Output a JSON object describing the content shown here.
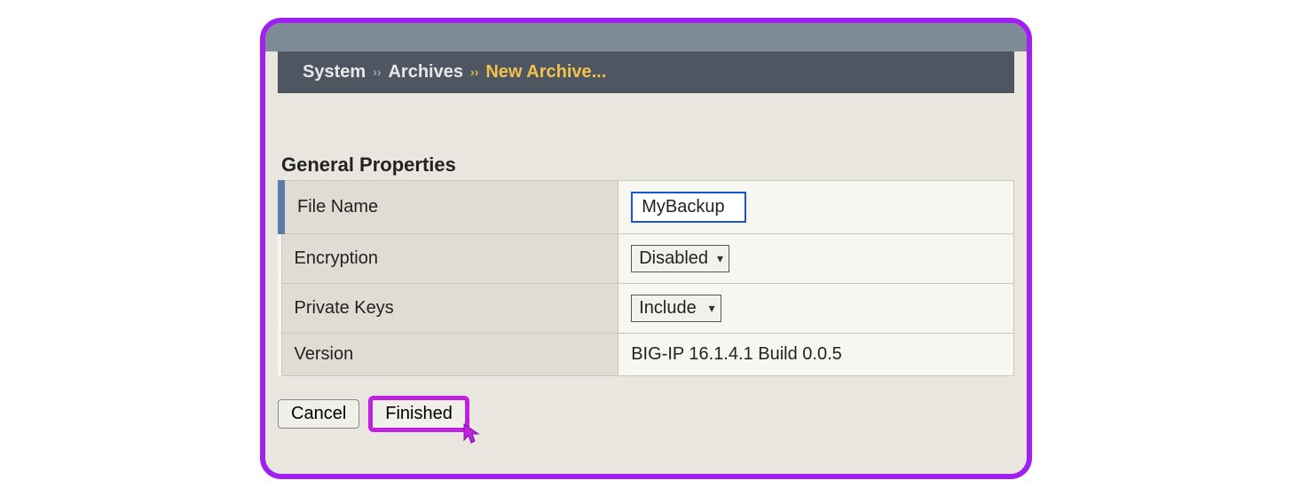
{
  "breadcrumb": {
    "item1": "System",
    "item2": "Archives",
    "active": "New Archive...",
    "sep": "››"
  },
  "section_title": "General Properties",
  "rows": {
    "file_name_label": "File Name",
    "file_name_value": "MyBackup",
    "encryption_label": "Encryption",
    "encryption_value": "Disabled",
    "private_keys_label": "Private Keys",
    "private_keys_value": "Include",
    "version_label": "Version",
    "version_value": "BIG-IP 16.1.4.1 Build 0.0.5"
  },
  "buttons": {
    "cancel": "Cancel",
    "finished": "Finished"
  }
}
